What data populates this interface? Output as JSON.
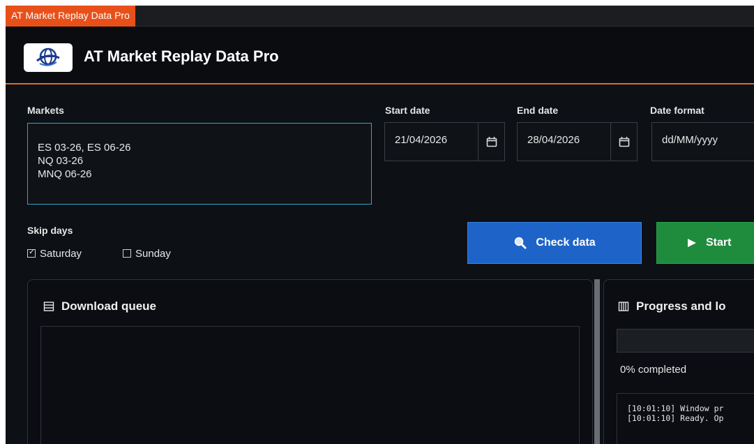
{
  "window": {
    "title": "AT Market Replay Data Pro"
  },
  "header": {
    "logo_icon": "globe-icon",
    "title": "AT Market Replay Data Pro"
  },
  "markets": {
    "label": "Markets",
    "lines": [
      "ES 03-26, ES 06-26",
      "NQ 03-26",
      "MNQ 06-26"
    ]
  },
  "start_date": {
    "label": "Start date",
    "value": "21/04/2026",
    "icon": "calendar-icon"
  },
  "end_date": {
    "label": "End date",
    "value": "28/04/2026",
    "icon": "calendar-icon"
  },
  "date_format": {
    "label": "Date format",
    "value": "dd/MM/yyyy"
  },
  "skip_days": {
    "label": "Skip days",
    "options": [
      {
        "label": "Saturday",
        "checked": true
      },
      {
        "label": "Sunday",
        "checked": false
      }
    ]
  },
  "buttons": {
    "check_data": {
      "label": "Check data",
      "icon": "magnifier-icon"
    },
    "start": {
      "label": "Start",
      "icon": "play-icon"
    }
  },
  "queue_panel": {
    "title": "Download queue",
    "icon": "list-icon"
  },
  "progress_panel": {
    "title": "Progress and lo",
    "icon": "bars-icon",
    "progress": 0,
    "status": "0% completed",
    "log": [
      "[10:01:10] Window pr",
      "[10:01:10] Ready. Op"
    ]
  },
  "colors": {
    "accent": "#e36a22",
    "title_tab": "#e8501a",
    "check_button": "#1e64c8",
    "start_button": "#1f8c3d",
    "focus_border": "#33a7c4"
  }
}
